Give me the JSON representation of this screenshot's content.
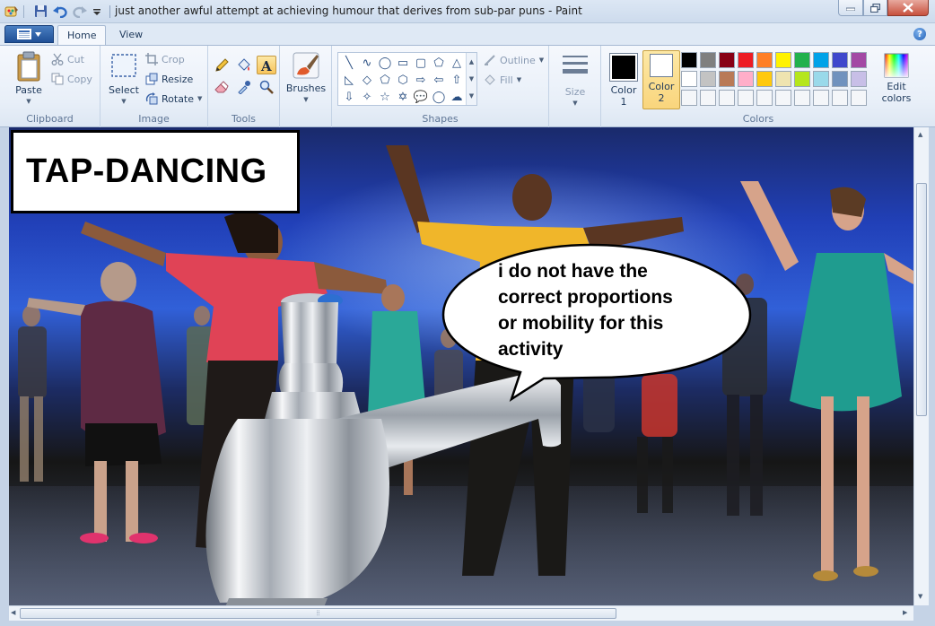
{
  "window": {
    "title": "just another awful attempt at achieving humour that derives from sub-par puns - Paint"
  },
  "tabs": [
    {
      "label": "Home",
      "active": true
    },
    {
      "label": "View",
      "active": false
    }
  ],
  "ribbon": {
    "clipboard": {
      "group_label": "Clipboard",
      "paste": "Paste",
      "cut": "Cut",
      "copy": "Copy"
    },
    "image": {
      "group_label": "Image",
      "select": "Select",
      "crop": "Crop",
      "resize": "Resize",
      "rotate": "Rotate"
    },
    "tools": {
      "group_label": "Tools",
      "icons": [
        "pencil-icon",
        "fill-icon",
        "text-icon",
        "eraser-icon",
        "color-picker-icon",
        "magnifier-icon"
      ]
    },
    "brushes": {
      "label": "Brushes"
    },
    "shapes": {
      "group_label": "Shapes",
      "outline": "Outline",
      "fill": "Fill"
    },
    "size": {
      "label": "Size"
    },
    "colors": {
      "group_label": "Colors",
      "color1_label": "Color",
      "color1_num": "1",
      "color1_value": "#000000",
      "color2_label": "Color",
      "color2_num": "2",
      "color2_value": "#ffffff",
      "edit_label": "Edit",
      "edit_label2": "colors",
      "palette": [
        "#000000",
        "#7f7f7f",
        "#880015",
        "#ed1c24",
        "#ff7f27",
        "#fff200",
        "#22b14c",
        "#00a2e8",
        "#3f48cc",
        "#a349a4",
        "#ffffff",
        "#c3c3c3",
        "#b97a57",
        "#ffaec9",
        "#ffc90e",
        "#efe4b0",
        "#b5e61d",
        "#99d9ea",
        "#7092be",
        "#c8bfe7",
        "#f4f6f9",
        "#f4f6f9",
        "#f4f6f9",
        "#f4f6f9",
        "#f4f6f9",
        "#f4f6f9",
        "#f4f6f9",
        "#f4f6f9",
        "#f4f6f9",
        "#f4f6f9"
      ]
    }
  },
  "canvas": {
    "caption": "TAP-DANCING",
    "speech_lines": [
      "i do not have the",
      "correct proportions",
      "or mobility for this",
      "activity"
    ]
  }
}
